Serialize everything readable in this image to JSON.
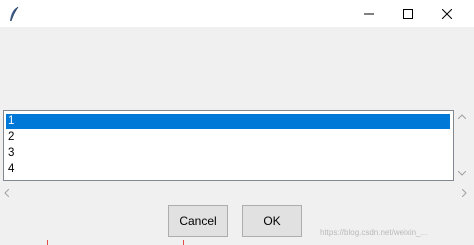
{
  "window": {
    "title": "",
    "controls": {
      "minimize": "minimize-icon",
      "maximize": "maximize-icon",
      "close": "close-icon"
    }
  },
  "listbox": {
    "items": [
      {
        "label": "1",
        "selected": true
      },
      {
        "label": "2",
        "selected": false
      },
      {
        "label": "3",
        "selected": false
      },
      {
        "label": "4",
        "selected": false
      }
    ],
    "selection_color": "#0078d7"
  },
  "buttons": {
    "cancel_label": "Cancel",
    "ok_label": "OK"
  },
  "watermark": "https://blog.csdn.net/weixin_..."
}
